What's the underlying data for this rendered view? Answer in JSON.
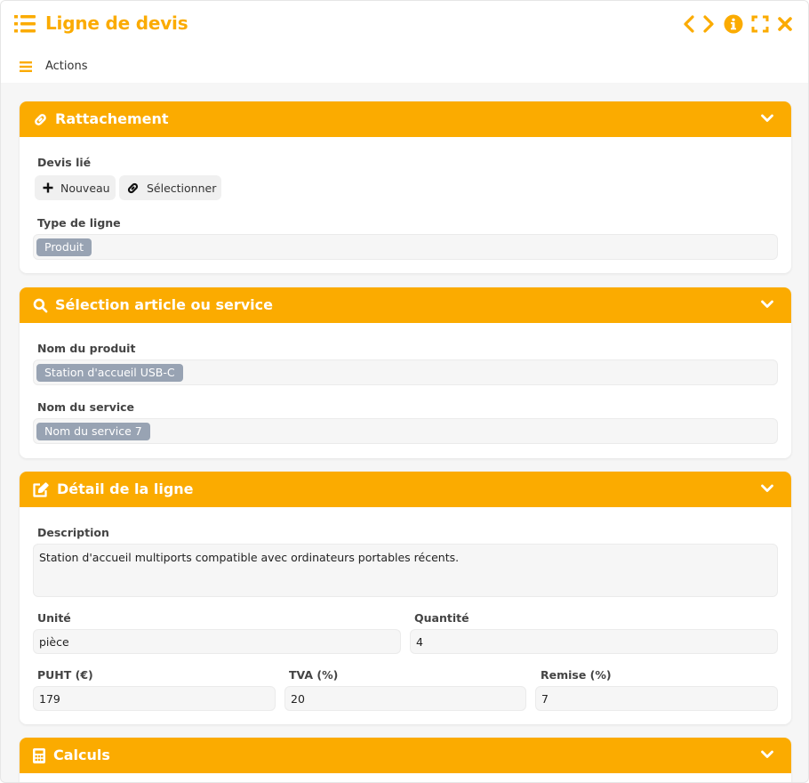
{
  "window": {
    "title": "Ligne de devis",
    "accent_color": "#fbab00"
  },
  "toolbar": {
    "actions_label": "Actions",
    "icons": [
      "app-list-icon",
      "chevron-left-icon",
      "chevron-right-icon",
      "info-icon",
      "fullscreen-icon",
      "close-icon",
      "menu-icon"
    ]
  },
  "sections": {
    "rattachement": {
      "title": "Rattachement",
      "icon": "link-icon",
      "devis_lie_label": "Devis lié",
      "new_button": "Nouveau",
      "select_button": "Sélectionner",
      "type_label": "Type de ligne",
      "type_value": "Produit"
    },
    "selection": {
      "title": "Sélection article ou service",
      "icon": "search-icon",
      "product_label": "Nom du produit",
      "product_value": "Station d'accueil USB-C",
      "service_label": "Nom du service",
      "service_value": "Nom du service 7"
    },
    "detail": {
      "title": "Détail de la ligne",
      "icon": "edit-icon",
      "description_label": "Description",
      "description_value": "Station d'accueil multiports compatible avec ordinateurs portables récents.",
      "unit_label": "Unité",
      "unit_value": "pièce",
      "quantity_label": "Quantité",
      "quantity_value": "4",
      "puht_label": "PUHT (€)",
      "puht_value": "179",
      "tva_label": "TVA (%)",
      "tva_value": "20",
      "remise_label": "Remise (%)",
      "remise_value": "7"
    },
    "calculs": {
      "title": "Calculs",
      "icon": "calculator-icon"
    }
  }
}
